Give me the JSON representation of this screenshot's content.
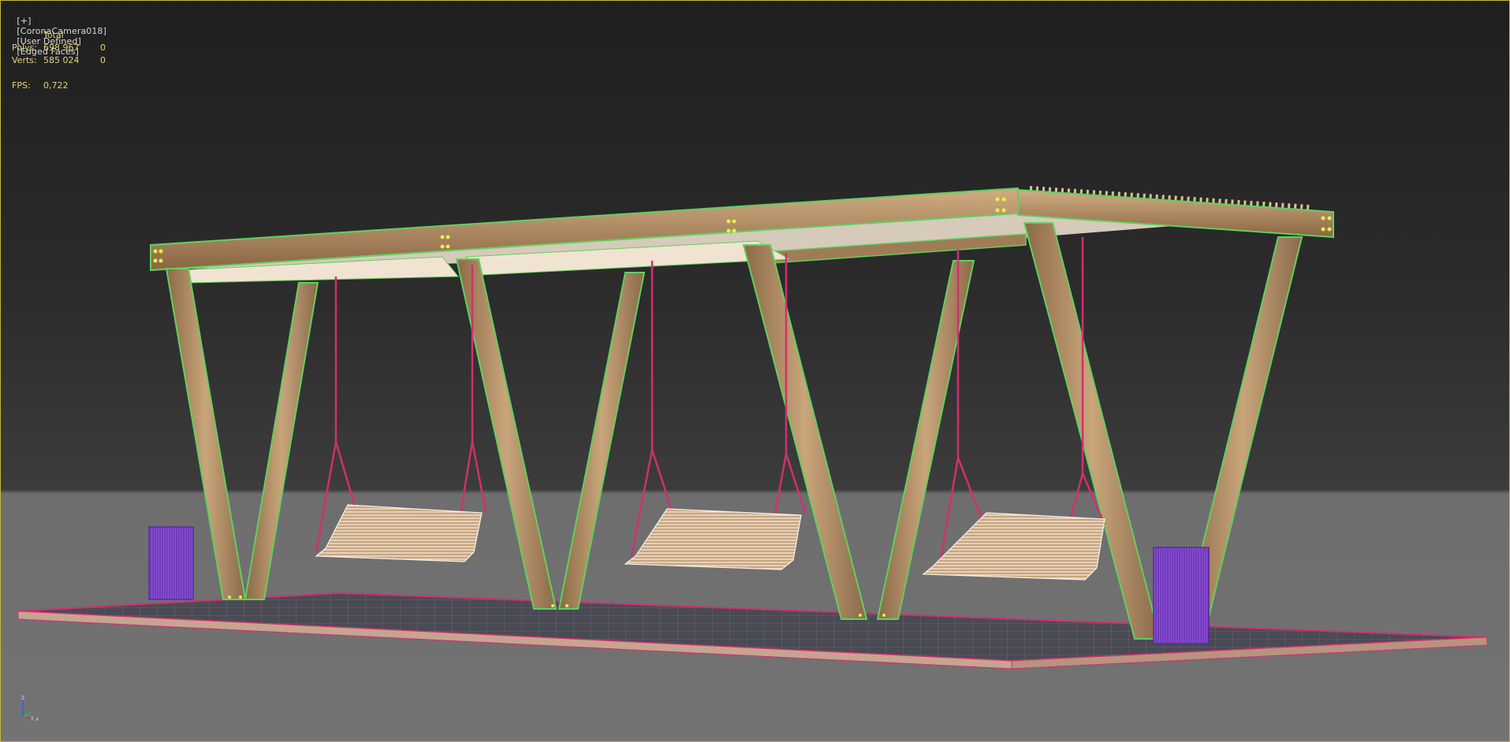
{
  "viewport": {
    "label_parts": [
      "[+]",
      "[CoronaCamera018]",
      "[User Defined]",
      "[Edged Faces]"
    ]
  },
  "stats": {
    "header": "Total",
    "rows": [
      {
        "label": "Polys:",
        "total": "698 967",
        "selected": "0"
      },
      {
        "label": "Verts:",
        "total": "585 024",
        "selected": "0"
      }
    ],
    "fps_label": "FPS:",
    "fps_value": "0,722"
  },
  "gizmo": {
    "z": "z",
    "y": "y",
    "x": "x"
  },
  "colors": {
    "border": "#c8b63e",
    "stats_text": "#e6d27a",
    "wood": "#b8946a",
    "wood_edge": "#5fd05f",
    "rope": "#d0306e",
    "bin": "#7a3fc4",
    "floor": "#4b4b55",
    "floor_edge": "#d0306e"
  },
  "scene_icons": [
    "pergola-swing-model",
    "trash-bin-model",
    "swing-seat-model",
    "floor-grid-model"
  ]
}
